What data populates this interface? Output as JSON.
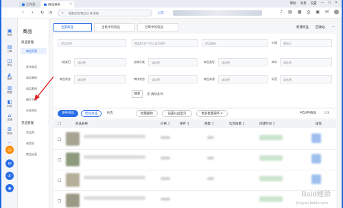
{
  "browser": {
    "tabs": [
      {
        "label": "工作台",
        "icon": "home-icon"
      },
      {
        "label": "商品发布",
        "icon": "tab-icon"
      }
    ],
    "top_right_labels": [
      "帮助",
      "消息",
      "设置"
    ],
    "address": "搜索应用/商品/订单/其他",
    "notice_label": "公告",
    "back_icon": "back-arrow-icon",
    "forward_icon": "forward-arrow-icon",
    "refresh_icon": "refresh-icon"
  },
  "rail": {
    "items": [
      {
        "label": "商品",
        "icon": "box-icon"
      },
      {
        "label": "订单",
        "icon": "doc-icon"
      },
      {
        "label": "售后",
        "icon": "chat-icon"
      },
      {
        "label": "营销",
        "icon": "megaphone-icon"
      },
      {
        "label": "数据",
        "icon": "chart-icon"
      },
      {
        "label": "财务",
        "icon": "wallet-icon"
      },
      {
        "label": "店铺",
        "icon": "store-icon"
      },
      {
        "label": "物流",
        "icon": "truck-icon"
      },
      {
        "label": "更多",
        "icon": "grid-icon"
      }
    ]
  },
  "sidebar": {
    "title": "商品",
    "groups": [
      {
        "label": "商品管理",
        "items": [
          "商品列表",
          "发布商品",
          "商品装修",
          "商品素材",
          "图片空间",
          "仓库库存"
        ]
      },
      {
        "label": "货品管理",
        "items": [
          "货品库",
          "淘货机",
          "商品标签"
        ]
      }
    ],
    "active_item": "商品列表"
  },
  "main": {
    "tabs": [
      "全部商品",
      "出售中的商品",
      "仓库中的商品"
    ],
    "active_tab": "全部商品",
    "top_actions": [
      "新建商品",
      "回收站"
    ],
    "filters": {
      "row1": [
        {
          "label": "",
          "placeholder": "商品名称"
        },
        {
          "label": "",
          "placeholder": "多个ID以逗号隔开"
        },
        {
          "label": "",
          "placeholder": "商品编码"
        },
        {
          "label": "价格",
          "placeholder": "最低价"
        }
      ],
      "row2": [
        {
          "label": "一级类目",
          "placeholder": "请选择"
        },
        {
          "label": "店铺分类",
          "placeholder": "请选择"
        },
        {
          "label": "商品类型",
          "placeholder": "请选择"
        },
        {
          "label": "库存",
          "placeholder": "请选择"
        }
      ],
      "row3": [
        {
          "label": "商品状态",
          "placeholder": "请选择"
        },
        {
          "label": "审核状态",
          "placeholder": "请选择"
        },
        {
          "label": "商品来源",
          "placeholder": "请选择"
        },
        {
          "label": "标签",
          "placeholder": "请选择"
        }
      ],
      "search_label": "搜索",
      "collapse_label": "点 清除条件"
    },
    "actions": {
      "publish": "发布商品",
      "optimize": "优化商品",
      "offline": "已选",
      "batch_delete": "批量删除",
      "batch_set": "设置公益宝贝",
      "more": "更多批量操作 ▾",
      "count": "共53件商品",
      "pager": "1/3"
    },
    "table": {
      "headers": [
        "商品名称",
        "价格 ↕",
        "库存 ↕",
        "销量 ↕",
        "信息质量 ↕",
        "创建时间 ↕",
        "操作"
      ],
      "rows": 4
    }
  },
  "watermark": {
    "text": "Baid经验",
    "sub": "jingyan.baidu.com"
  },
  "colors": {
    "accent": "#2a6de8",
    "frame": "#1a66e0",
    "arrow": "#e02020"
  }
}
